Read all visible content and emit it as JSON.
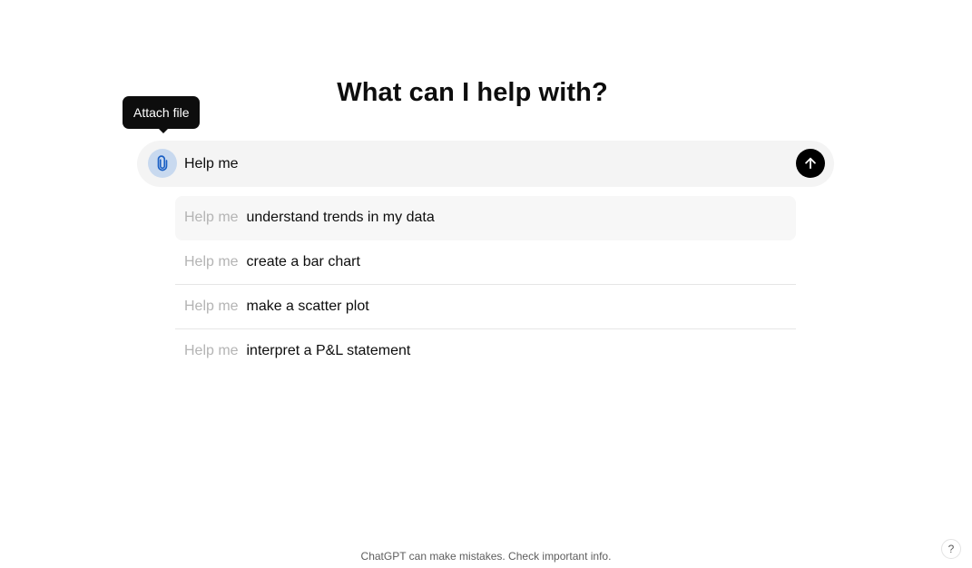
{
  "headline": "What can I help with?",
  "tooltip": {
    "text": "Attach file"
  },
  "composer": {
    "attach_icon": "paperclip-icon",
    "input_value": "Help me",
    "send_icon": "arrow-up-icon",
    "send_color": "#000000",
    "attach_highlight_color": "#c8d9ef"
  },
  "suggestions": [
    {
      "prefix": "Help me",
      "text": "understand trends in my data"
    },
    {
      "prefix": "Help me",
      "text": "create a bar chart"
    },
    {
      "prefix": "Help me",
      "text": "make a scatter plot"
    },
    {
      "prefix": "Help me",
      "text": "interpret a P&L statement"
    }
  ],
  "footer": {
    "note": "ChatGPT can make mistakes. Check important info."
  },
  "help": {
    "label": "?"
  }
}
